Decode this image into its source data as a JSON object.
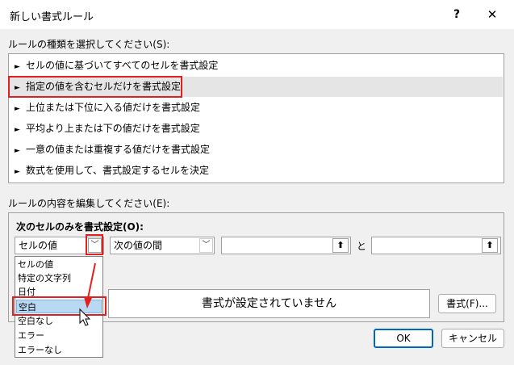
{
  "window": {
    "title": "新しい書式ルール",
    "help_label": "?",
    "close_label": "✕"
  },
  "rule_type": {
    "label": "ルールの種類を選択してください(S):",
    "items": [
      "セルの値に基づいてすべてのセルを書式設定",
      "指定の値を含むセルだけを書式設定",
      "上位または下位に入る値だけを書式設定",
      "平均より上または下の値だけを書式設定",
      "一意の値または重複する値だけを書式設定",
      "数式を使用して、書式設定するセルを決定"
    ],
    "selected_index": 1
  },
  "rule_edit": {
    "label": "ルールの内容を編集してください(E):",
    "heading": "次のセルのみを書式設定(O):",
    "condition_value": "セルの値",
    "operator_value": "次の値の間",
    "and_label": "と",
    "value1": "",
    "value2": "",
    "preview_text": "書式が設定されていません",
    "format_button": "書式(F)..."
  },
  "dropdown": {
    "options": [
      "セルの値",
      "特定の文字列",
      "日付",
      "空白",
      "空白なし",
      "エラー",
      "エラーなし"
    ],
    "highlighted_index": 3
  },
  "footer": {
    "ok_label": "OK",
    "cancel_label": "キャンセル"
  },
  "colors": {
    "highlight_red": "#e02020",
    "accent_blue": "#0067c0",
    "selection_bg": "#b9d9f3"
  }
}
